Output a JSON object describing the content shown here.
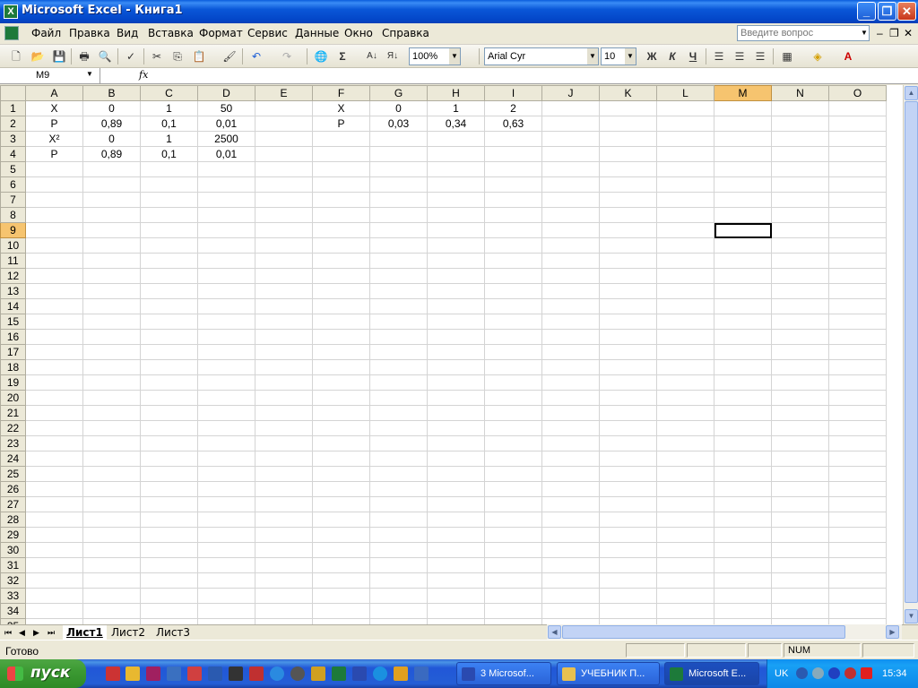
{
  "window": {
    "title": "Microsoft Excel - Книга1"
  },
  "menu": {
    "items": [
      "Файл",
      "Правка",
      "Вид",
      "Вставка",
      "Формат",
      "Сервис",
      "Данные",
      "Окно",
      "Справка"
    ]
  },
  "ask": {
    "placeholder": "Введите вопрос"
  },
  "toolbar": {
    "zoom": "100%",
    "font": "Arial Cyr",
    "size": "10",
    "bold": "Ж",
    "italic": "К",
    "underline": "Ч",
    "sum": "Σ"
  },
  "formula": {
    "cell_ref": "M9",
    "fx": "fx",
    "value": ""
  },
  "grid": {
    "columns": [
      "A",
      "B",
      "C",
      "D",
      "E",
      "F",
      "G",
      "H",
      "I",
      "J",
      "K",
      "L",
      "M",
      "N",
      "O"
    ],
    "selected_column": "M",
    "selected_row": 9,
    "active_cell": "M9",
    "row_count": 35,
    "cells": {
      "A1": "X",
      "B1": "0",
      "C1": "1",
      "D1": "50",
      "F1": "X",
      "G1": "0",
      "H1": "1",
      "I1": "2",
      "A2": "P",
      "B2": "0,89",
      "C2": "0,1",
      "D2": "0,01",
      "F2": "P",
      "G2": "0,03",
      "H2": "0,34",
      "I2": "0,63",
      "A3": "X²",
      "B3": "0",
      "C3": "1",
      "D3": "2500",
      "A4": "P",
      "B4": "0,89",
      "C4": "0,1",
      "D4": "0,01"
    }
  },
  "sheets": {
    "tabs": [
      "Лист1",
      "Лист2",
      "Лист3"
    ],
    "active": "Лист1"
  },
  "status": {
    "ready": "Готово",
    "num": "NUM"
  },
  "taskbar": {
    "start": "пуск",
    "tasks": [
      "3 Microsof...",
      "УЧЕБНИК П...",
      "Microsoft E..."
    ],
    "lang": "UK",
    "clock": "15:34"
  }
}
